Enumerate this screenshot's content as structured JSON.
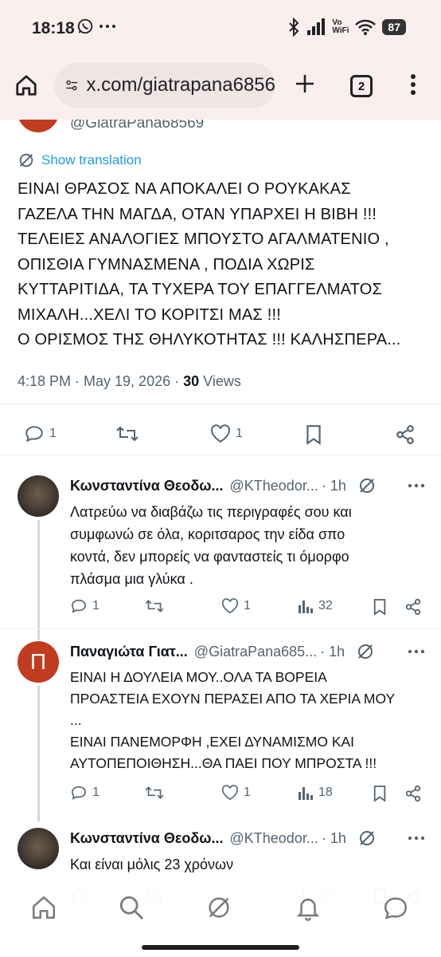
{
  "status_bar": {
    "time": "18:18",
    "volte_top": "Vo",
    "volte_bottom": "WiFi",
    "battery": "87"
  },
  "browser": {
    "url": "x.com/giatrapana6856",
    "tab_count": "2"
  },
  "main_post": {
    "handle": "@GiatraPana68569",
    "show_translation": "Show translation",
    "text_lines": [
      "ΕΙΝΑΙ ΘΡΑΣΟΣ ΝΑ ΑΠΟΚΑΛΕΙ Ο ΡΟΥΚΑΚΑΣ",
      "ΓΑΖΕΛΑ ΤΗΝ ΜΑΓΔΑ, ΟΤΑΝ ΥΠΑΡΧΕΙ Η ΒΙΒΗ !!!",
      "ΤΕΛΕΙΕΣ ΑΝΑΛΟΓΙΕΣ ΜΠΟΥΣΤΟ ΑΓΑΛΜΑΤΕΝΙΟ ,",
      "ΟΠΙΣΘΙΑ ΓΥΜΝΑΣΜΕΝΑ , ΠΟΔΙΑ ΧΩΡΙΣ",
      "ΚΥΤΤΑΡΙΤΙΔΑ, ΤΑ ΤΥΧΕΡΑ ΤΟΥ  ΕΠΑΓΓΕΛΜΑΤΟΣ",
      "ΜΙΧΑΛΗ...ΧΕΛΙ ΤΟ ΚΟΡΙΤΣΙ ΜΑΣ !!!",
      "Ο ΟΡΙΣΜΟΣ ΤΗΣ ΘΗΛΥΚΟΤΗΤΑΣ !!! ΚΑΛΗΣΠΕΡΑ..."
    ],
    "time": "4:18 PM · May 19, 2026 · ",
    "views_count": "30",
    "views_label": " Views",
    "replies": "1",
    "likes": "1"
  },
  "replies": [
    {
      "name": "Κωνσταντίνα Θεοδω...",
      "handle": "@KTheodor...",
      "time": "· 1h",
      "text_lines": [
        "Λατρεύω να διαβάζω τις περιγραφές σου και",
        "συμφωνώ σε όλα, κοριτσαρος   την είδα σπο",
        "κοντά, δεν μπορείς να φανταστείς  τι όμορφο",
        "πλάσμα μια γλύκα ."
      ],
      "replies": "1",
      "reposts": "",
      "likes": "1",
      "views": "32"
    },
    {
      "name": "Παναγιώτα Γιατ...",
      "handle": "@GiatraPana685...",
      "time": "· 1h",
      "avatar_letter": "Π",
      "text_lines": [
        "ΕΙΝΑΙ Η ΔΟΥΛΕΙΑ ΜΟΥ..ΟΛΑ ΤΑ ΒΟΡΕΙΑ",
        "ΠΡΟΑΣΤΕΙΑ ΕΧΟΥΝ ΠΕΡΑΣΕΙ ΑΠΟ ΤΑ ΧΕΡΙΑ ΜΟΥ",
        "...",
        "ΕΙΝΑΙ ΠΑΝΕΜΟΡΦΗ ,ΕΧΕΙ ΔΥΝΑΜΙΣΜΟ ΚΑΙ",
        "ΑΥΤΟΠΕΠΟΙΘΗΣΗ...ΘΑ ΠΑΕΙ ΠΟΥ ΜΠΡΟΣΤΑ !!!"
      ],
      "replies": "1",
      "likes": "1",
      "views": "18"
    },
    {
      "name": "Κωνσταντίνα Θεοδω...",
      "handle": "@KTheodor...",
      "time": "· 1h",
      "text_lines": [
        "Και είναι μόλις 23 χρόνων"
      ],
      "views": "13"
    }
  ],
  "colors": {
    "accent": "#1d9bf0",
    "secondary_text": "#536471",
    "avatar_red": "#c13c1f",
    "browser_bg": "#fbeeee"
  },
  "icons": {
    "status": [
      "whatsapp-icon",
      "more-dots-icon",
      "bluetooth-icon",
      "signal-icon",
      "wifi-icon",
      "battery-icon"
    ],
    "browser": [
      "home-icon",
      "site-settings-icon",
      "new-tab-plus-icon",
      "tab-switcher-icon",
      "overflow-menu-icon"
    ],
    "post_actions": [
      "reply-icon",
      "repost-icon",
      "like-icon",
      "bookmark-icon",
      "share-icon",
      "views-icon",
      "grok-icon"
    ],
    "bottom_nav": [
      "home-icon",
      "search-icon",
      "grok-icon",
      "notifications-icon",
      "messages-icon"
    ]
  }
}
